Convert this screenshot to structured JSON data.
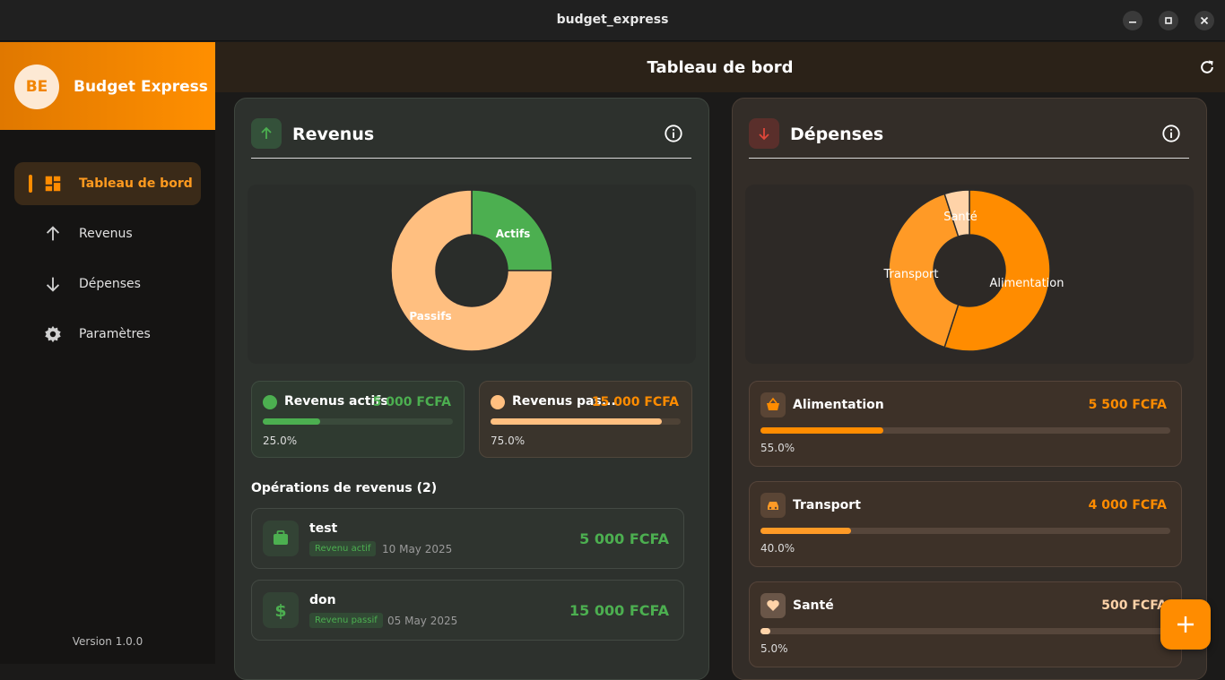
{
  "window": {
    "title": "budget_express"
  },
  "sidebar": {
    "brand_initials": "BE",
    "brand_name": "Budget Express",
    "items": [
      {
        "label": "Tableau de bord",
        "icon": "dashboard-icon",
        "active": true
      },
      {
        "label": "Revenus",
        "icon": "arrow-up-icon"
      },
      {
        "label": "Dépenses",
        "icon": "arrow-down-icon"
      },
      {
        "label": "Paramètres",
        "icon": "gear-icon"
      }
    ],
    "version": "Version 1.0.0"
  },
  "header": {
    "title": "Tableau de bord"
  },
  "revenus": {
    "title": "Revenus",
    "chart_labels": {
      "actifs": "Actifs",
      "passifs": "Passifs"
    },
    "cards": [
      {
        "label": "Revenus actifs",
        "value": "5 000 FCFA",
        "percent": "25.0%",
        "fraction": 0.3
      },
      {
        "label": "Revenus pas...",
        "value": "15 000 FCFA",
        "percent": "75.0%",
        "fraction": 0.9
      }
    ],
    "operations_title": "Opérations de revenus (2)",
    "operations": [
      {
        "name": "test",
        "tag": "Revenu actif",
        "date": "10 May 2025",
        "amount": "5 000 FCFA",
        "icon": "briefcase-icon"
      },
      {
        "name": "don",
        "tag": "Revenu passif",
        "date": "05 May 2025",
        "amount": "15 000 FCFA",
        "icon": "dollar-icon"
      }
    ]
  },
  "depenses": {
    "title": "Dépenses",
    "chart_labels": {
      "alimentation": "Alimentation",
      "transport": "Transport",
      "sante": "Santé"
    },
    "items": [
      {
        "name": "Alimentation",
        "value": "5 500 FCFA",
        "percent": "55.0%",
        "fraction": 0.3,
        "icon": "basket-icon"
      },
      {
        "name": "Transport",
        "value": "4 000 FCFA",
        "percent": "40.0%",
        "fraction": 0.22,
        "icon": "car-icon"
      },
      {
        "name": "Santé",
        "value": "500 FCFA",
        "percent": "5.0%",
        "fraction": 0.025,
        "icon": "heart-icon"
      }
    ]
  },
  "colors": {
    "accent": "#ff8c00",
    "green": "#4caf50",
    "peach": "#ffbf80",
    "light_peach": "#ffd3a8"
  },
  "chart_data": [
    {
      "type": "pie",
      "categories": [
        "Actifs",
        "Passifs"
      ],
      "values": [
        25,
        75
      ],
      "colors": [
        "#4caf50",
        "#ffbf80"
      ]
    },
    {
      "type": "pie",
      "categories": [
        "Alimentation",
        "Transport",
        "Santé"
      ],
      "values": [
        55,
        40,
        5
      ],
      "colors": [
        "#ff8c00",
        "#ff9a26",
        "#ffd3a8"
      ]
    }
  ]
}
